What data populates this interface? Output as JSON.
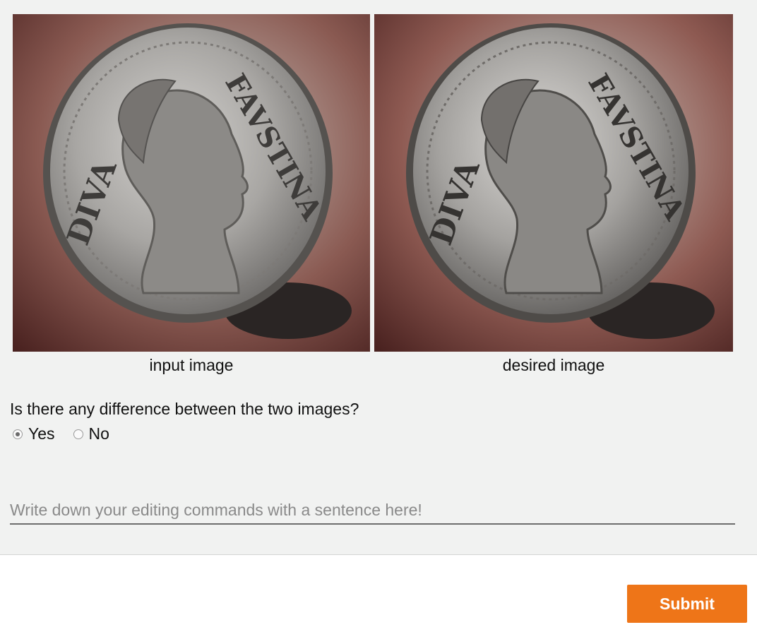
{
  "images": {
    "input": {
      "caption": "input image",
      "content": "Roman silver coin held between fingers, bust of Faustina"
    },
    "desired": {
      "caption": "desired image",
      "content": "Roman silver coin held between fingers, bust of Faustina, sharpened"
    }
  },
  "coin_inscription": {
    "left": "DIVA",
    "right": "FAVSTINA"
  },
  "question": {
    "text": "Is there any difference between the two images?",
    "options": [
      {
        "label": "Yes",
        "selected": true
      },
      {
        "label": "No",
        "selected": false
      }
    ]
  },
  "command_input": {
    "placeholder": "Write down your editing commands with a sentence here!",
    "value": ""
  },
  "submit": {
    "label": "Submit"
  },
  "colors": {
    "panel_bg": "#f1f2f1",
    "accent": "#ee7518"
  }
}
